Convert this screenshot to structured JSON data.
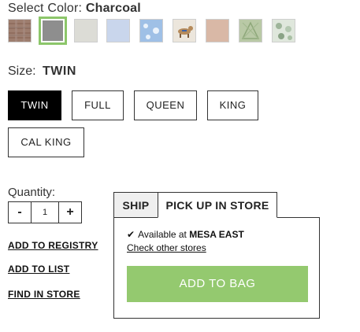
{
  "color": {
    "label": "Select Color:",
    "selected": "Charcoal",
    "swatches": [
      {
        "name": "plaid",
        "color": "#c9b3a8"
      },
      {
        "name": "charcoal",
        "color": "#8e8e8e"
      },
      {
        "name": "light-gray",
        "color": "#dcdcd6"
      },
      {
        "name": "light-blue",
        "color": "#c9d6ec"
      },
      {
        "name": "sky-print",
        "color": "#9fc0e6"
      },
      {
        "name": "dog-print",
        "color": "#ece6dc"
      },
      {
        "name": "blush",
        "color": "#d9b8a6"
      },
      {
        "name": "sage-print",
        "color": "#b9c9a6"
      },
      {
        "name": "floral-print",
        "color": "#dfe7dc"
      }
    ],
    "selected_color": "#8cc66a"
  },
  "size": {
    "label": "Size:",
    "selected": "TWIN",
    "options": [
      "TWIN",
      "FULL",
      "QUEEN",
      "KING",
      "CAL KING"
    ]
  },
  "quantity": {
    "label": "Quantity:",
    "minus": "-",
    "value": "1",
    "plus": "+"
  },
  "links": {
    "registry": "ADD TO REGISTRY",
    "list": "ADD TO LIST",
    "find": "FIND IN STORE"
  },
  "fulfillment": {
    "tabs": [
      "SHIP",
      "PICK UP IN STORE"
    ],
    "active_tab": "PICK UP IN STORE",
    "check": "✔",
    "available_text": "Available at",
    "store": "MESA EAST",
    "other_stores": "Check other stores",
    "add_to_bag": "ADD TO BAG",
    "button_color": "#94c96f"
  }
}
